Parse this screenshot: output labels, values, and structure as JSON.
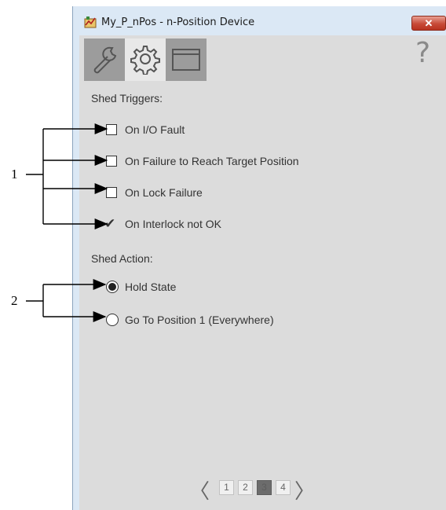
{
  "window": {
    "title": "My_P_nPos - n-Position Device",
    "close_label": "✕",
    "help_label": "?"
  },
  "tabs": [
    {
      "name": "maintenance",
      "icon": "wrench-icon",
      "active": false
    },
    {
      "name": "configuration",
      "icon": "gear-icon",
      "active": true
    },
    {
      "name": "faceplate",
      "icon": "window-icon",
      "active": false
    }
  ],
  "shed_triggers": {
    "label": "Shed Triggers:",
    "options": [
      {
        "label": "On I/O Fault",
        "checked": false
      },
      {
        "label": "On Failure to Reach Target Position",
        "checked": false
      },
      {
        "label": "On Lock Failure",
        "checked": false
      },
      {
        "label": "On Interlock not OK",
        "checked": true
      }
    ]
  },
  "shed_action": {
    "label": "Shed Action:",
    "options": [
      {
        "label": "Hold State",
        "selected": true
      },
      {
        "label": "Go To Position 1 (Everywhere)",
        "selected": false
      }
    ]
  },
  "pager": {
    "prev": "〈",
    "next": "〉",
    "pages": [
      "1",
      "2",
      "3",
      "4"
    ],
    "current": "3"
  },
  "callouts": [
    "1",
    "2"
  ]
}
